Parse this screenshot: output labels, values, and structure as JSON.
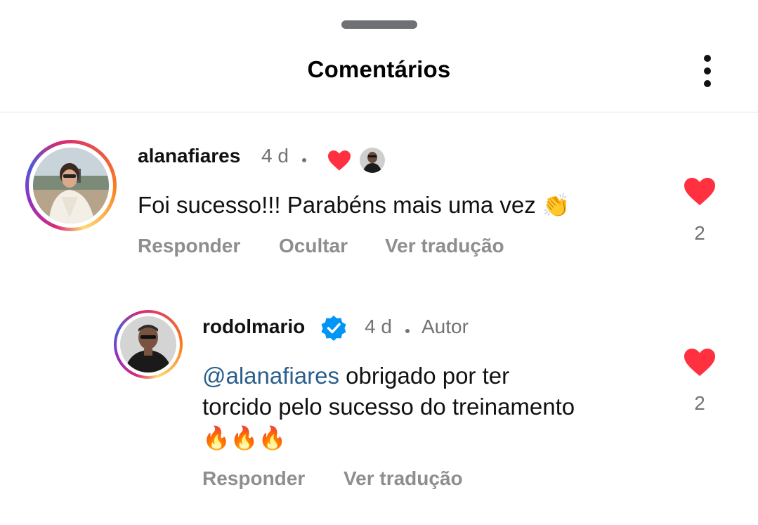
{
  "header": {
    "title": "Comentários",
    "menu_icon": "more-vertical-icon"
  },
  "comments": [
    {
      "username": "alanafiares",
      "time": "4 d",
      "text": "Foi sucesso!!! Parabéns mais uma vez",
      "emoji": "👏",
      "actions": {
        "reply": "Responder",
        "hide": "Ocultar",
        "translate": "Ver tradução"
      },
      "likes": "2",
      "author_liked_icon": "heart-icon"
    },
    {
      "username": "rodolmario",
      "verified": true,
      "time": "4 d",
      "author_badge": "Autor",
      "mention": "@alanafiares",
      "text_line1": " obrigado por ter",
      "text_line2": "torcido pelo sucesso do treinamento",
      "emoji": "🔥🔥🔥",
      "actions": {
        "reply": "Responder",
        "translate": "Ver tradução"
      },
      "likes": "2"
    }
  ],
  "colors": {
    "heart": "#ff3040",
    "verified": "#0095f6",
    "mention": "#2a5e8c",
    "secondary_text": "#737373"
  }
}
